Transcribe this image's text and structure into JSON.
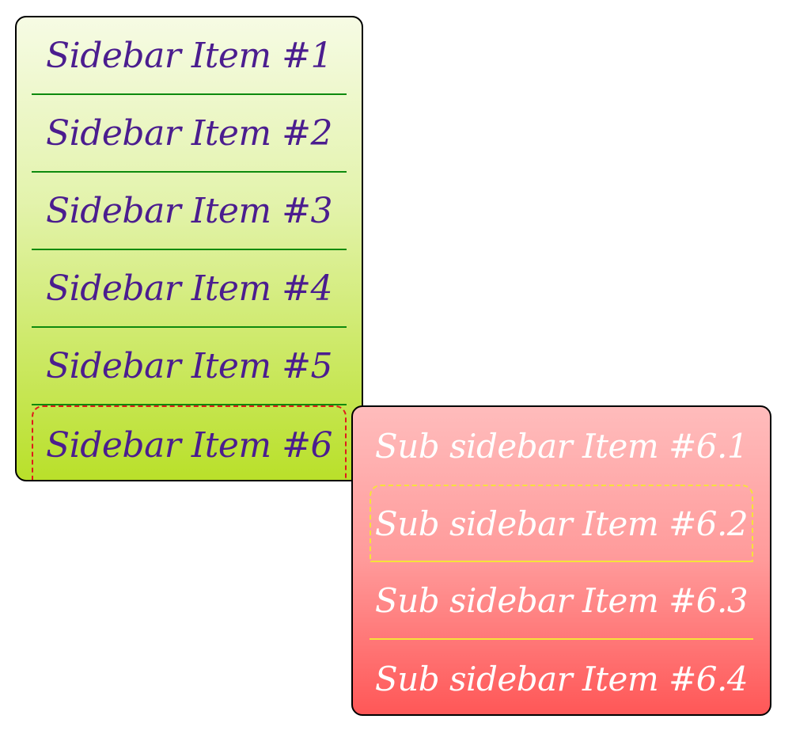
{
  "sidebar": {
    "items": [
      {
        "label": "Sidebar Item #1"
      },
      {
        "label": "Sidebar Item #2"
      },
      {
        "label": "Sidebar Item #3"
      },
      {
        "label": "Sidebar Item #4"
      },
      {
        "label": "Sidebar Item #5"
      },
      {
        "label": "Sidebar Item #6"
      }
    ],
    "active_index": 5
  },
  "subsidebar": {
    "items": [
      {
        "label": "Sub sidebar Item #6.1"
      },
      {
        "label": "Sub sidebar Item #6.2"
      },
      {
        "label": "Sub sidebar Item #6.3"
      },
      {
        "label": "Sub sidebar Item #6.4"
      }
    ],
    "active_index": 1
  },
  "colors": {
    "sidebar_text": "#4b1d8f",
    "sidebar_divider": "#0d8a0d",
    "sidebar_active_border": "#e01a1a",
    "subbar_text": "#ffffff",
    "subbar_divider": "#f6e23a"
  }
}
